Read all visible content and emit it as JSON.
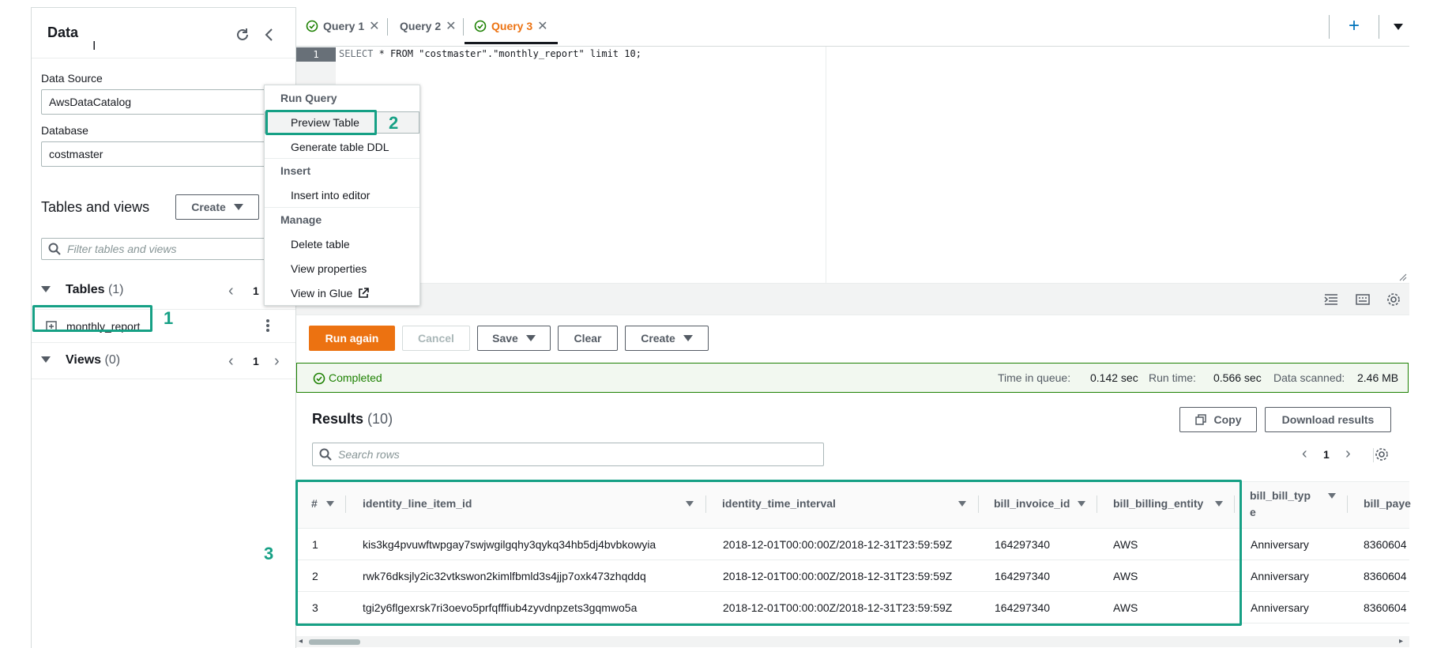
{
  "left_panel": {
    "title": "Data",
    "data_source_label": "Data Source",
    "data_source_value": "AwsDataCatalog",
    "database_label": "Database",
    "database_value": "costmaster",
    "tables_views_title": "Tables and views",
    "create_button": "Create",
    "filter_placeholder": "Filter tables and views",
    "tables_label": "Tables",
    "tables_count": "(1)",
    "tables_page": "1",
    "table_item": "monthly_report",
    "views_label": "Views",
    "views_count": "(0)",
    "views_page": "1"
  },
  "context_menu": {
    "group_run": "Run Query",
    "preview_table": "Preview Table",
    "generate_ddl": "Generate table DDL",
    "group_insert": "Insert",
    "insert_editor": "Insert into editor",
    "group_manage": "Manage",
    "delete_table": "Delete table",
    "view_properties": "View properties",
    "view_glue": "View in Glue"
  },
  "tabs": [
    {
      "label": "Query 1",
      "active": false
    },
    {
      "label": "Query 2",
      "active": false
    },
    {
      "label": "Query 3",
      "active": true
    }
  ],
  "editor": {
    "line_number": "1",
    "code_keyword_select": "SELECT",
    "code_rest": " * FROM \"costmaster\".\"monthly_report\" limit 10;"
  },
  "toolbar": {
    "run_again": "Run again",
    "cancel": "Cancel",
    "save": "Save",
    "clear": "Clear",
    "create": "Create"
  },
  "status": {
    "state": "Completed",
    "queue_label": "Time in queue:",
    "queue_value": "0.142 sec",
    "run_label": "Run time:",
    "run_value": "0.566 sec",
    "scanned_label": "Data scanned:",
    "scanned_value": "2.46 MB"
  },
  "results": {
    "title": "Results",
    "count": "(10)",
    "copy": "Copy",
    "download": "Download results",
    "search_placeholder": "Search rows",
    "page": "1",
    "columns": [
      "#",
      "identity_line_item_id",
      "identity_time_interval",
      "bill_invoice_id",
      "bill_billing_entity",
      "bill_bill_typ",
      "e",
      "bill_paye"
    ],
    "rows": [
      [
        "1",
        "kis3kg4pvuwftwpgay7swjwgilgqhy3qykq34hb5dj4bvbkowyia",
        "2018-12-01T00:00:00Z/2018-12-31T23:59:59Z",
        "164297340",
        "AWS",
        "Anniversary",
        "8360604"
      ],
      [
        "2",
        "rwk76dksjly2ic32vtkswon2kimlfbmld3s4jjp7oxk473zhqddq",
        "2018-12-01T00:00:00Z/2018-12-31T23:59:59Z",
        "164297340",
        "AWS",
        "Anniversary",
        "8360604"
      ],
      [
        "3",
        "tgi2y6flgexrsk7ri3oevo5prfqfffiub4zyvdnpzets3gqmwo5a",
        "2018-12-01T00:00:00Z/2018-12-31T23:59:59Z",
        "164297340",
        "AWS",
        "Anniversary",
        "8360604"
      ]
    ]
  },
  "annotations": {
    "step1": "1",
    "step2": "2",
    "step3": "3",
    "color": "#16a085"
  },
  "colors": {
    "accent": "#ec7211",
    "success": "#1d8102",
    "annotation": "#16a085"
  }
}
